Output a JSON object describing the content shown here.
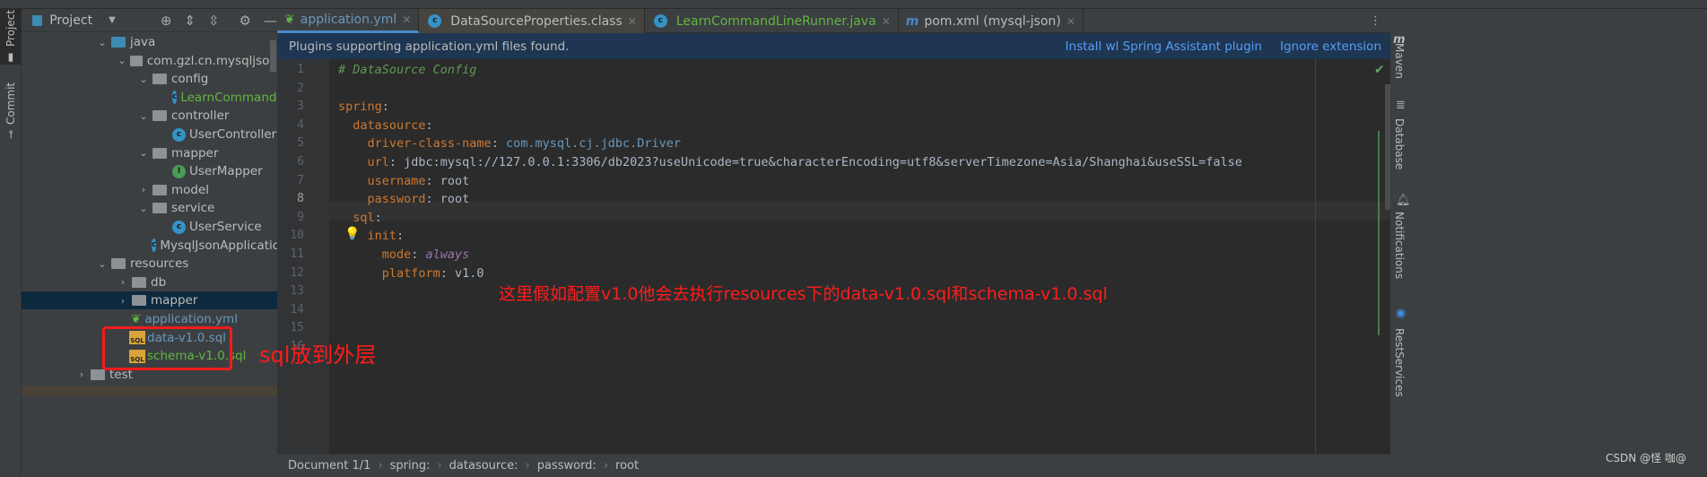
{
  "left_strip": {
    "project": "Project",
    "commit": "Commit"
  },
  "project_panel": {
    "title": "Project",
    "tree": [
      {
        "label": "java",
        "type": "folder-src",
        "depth": 0,
        "expanded": true
      },
      {
        "label": "com.gzl.cn.mysqljson",
        "type": "package",
        "depth": 1,
        "expanded": true
      },
      {
        "label": "config",
        "type": "package",
        "depth": 2,
        "expanded": true
      },
      {
        "label": "LearnCommandLineRunner",
        "type": "class",
        "depth": 3,
        "color": "green"
      },
      {
        "label": "controller",
        "type": "package",
        "depth": 2,
        "expanded": true
      },
      {
        "label": "UserController",
        "type": "class",
        "depth": 3
      },
      {
        "label": "mapper",
        "type": "package",
        "depth": 2,
        "expanded": true
      },
      {
        "label": "UserMapper",
        "type": "interface",
        "depth": 3
      },
      {
        "label": "model",
        "type": "package",
        "depth": 2,
        "expanded": false
      },
      {
        "label": "service",
        "type": "package",
        "depth": 2,
        "expanded": true
      },
      {
        "label": "UserService",
        "type": "class",
        "depth": 3
      },
      {
        "label": "MysqlJsonApplication",
        "type": "spring-class",
        "depth": 2
      },
      {
        "label": "resources",
        "type": "folder-res",
        "depth": 0,
        "expanded": true
      },
      {
        "label": "db",
        "type": "folder",
        "depth": 1,
        "expanded": false
      },
      {
        "label": "mapper",
        "type": "folder",
        "depth": 1,
        "expanded": false,
        "selected": true
      },
      {
        "label": "application.yml",
        "type": "yml",
        "depth": 1,
        "color": "blue"
      },
      {
        "label": "data-v1.0.sql",
        "type": "sql",
        "depth": 1,
        "color": "blue"
      },
      {
        "label": "schema-v1.0.sql",
        "type": "sql",
        "depth": 1,
        "color": "green"
      },
      {
        "label": "test",
        "type": "folder",
        "depth": -1,
        "expanded": false
      }
    ]
  },
  "tabs": [
    {
      "label": "application.yml",
      "active": true,
      "icon": "spring-yml-icon"
    },
    {
      "label": "DataSourceProperties.class",
      "icon": "class-icon"
    },
    {
      "label": "LearnCommandLineRunner.java",
      "icon": "class-icon"
    },
    {
      "label": "pom.xml (mysql-json)",
      "icon": "maven-icon"
    }
  ],
  "banner": {
    "message": "Plugins supporting application.yml files found.",
    "install": "Install wl Spring Assistant plugin",
    "ignore": "Ignore extension"
  },
  "editor": {
    "current_line": 8,
    "lines": [
      [
        {
          "t": "# DataSource Config",
          "c": "c"
        }
      ],
      [],
      [
        {
          "t": "spring",
          "c": "k"
        },
        {
          "t": ":"
        }
      ],
      [
        {
          "t": "  datasource",
          "c": "k"
        },
        {
          "t": ":"
        }
      ],
      [
        {
          "t": "    driver-class-name",
          "c": "k"
        },
        {
          "t": ": "
        },
        {
          "t": "com.mysql.cj.jdbc.Driver",
          "c": "s"
        }
      ],
      [
        {
          "t": "    url",
          "c": "k"
        },
        {
          "t": ": jdbc:mysql://127.0.0.1:3306/db2023?useUnicode=true&characterEncoding=utf8&serverTimezone=Asia/Shanghai&useSSL=false"
        }
      ],
      [
        {
          "t": "    username",
          "c": "k"
        },
        {
          "t": ": root"
        }
      ],
      [
        {
          "t": "    password",
          "c": "k"
        },
        {
          "t": ": root"
        }
      ],
      [
        {
          "t": "  sql",
          "c": "k"
        },
        {
          "t": ":"
        }
      ],
      [
        {
          "t": "    init",
          "c": "k"
        },
        {
          "t": ":"
        }
      ],
      [
        {
          "t": "      mode",
          "c": "k"
        },
        {
          "t": ": "
        },
        {
          "t": "always",
          "c": "e"
        }
      ],
      [
        {
          "t": "      platform",
          "c": "k"
        },
        {
          "t": ": v1.0"
        }
      ],
      [],
      [],
      [],
      []
    ]
  },
  "annotations": {
    "platform_note": "这里假如配置v1.0他会去执行resources下的data-v1.0.sql和schema-v1.0.sql",
    "sql_note": "sql放到外层"
  },
  "breadcrumb": [
    "Document 1/1",
    "spring:",
    "datasource:",
    "password:",
    "root"
  ],
  "right_tools": [
    "Maven",
    "Database",
    "Notifications",
    "RestServices"
  ],
  "watermark": "CSDN @怪 咖@"
}
